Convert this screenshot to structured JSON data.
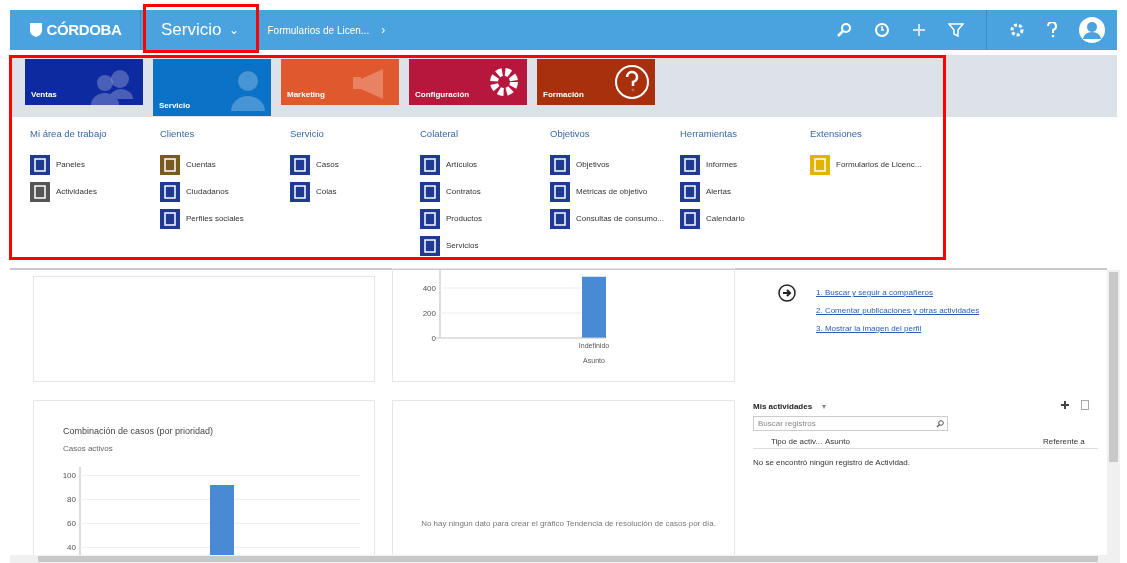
{
  "top_bar": {
    "logo": "CÓRDOBA",
    "area": {
      "label": "Servicio",
      "caret": "⌄",
      "highlighted": true
    },
    "breadcrumb": {
      "label": "Formularios de Licen...",
      "caret": "›"
    }
  },
  "menu": {
    "highlighted": true,
    "tiles": [
      {
        "label": "Ventas",
        "color": "#0e2aa0",
        "selected": false
      },
      {
        "label": "Servicio",
        "color": "#0a72c7",
        "selected": true
      },
      {
        "label": "Marketing",
        "color": "#e0582e",
        "selected": false
      },
      {
        "label": "Configuración",
        "color": "#b8173d",
        "selected": false
      },
      {
        "label": "Formación",
        "color": "#a9300c",
        "selected": false
      }
    ],
    "groups": [
      {
        "title": "Mi área de trabajo",
        "items": [
          "Paneles",
          "Actividades"
        ]
      },
      {
        "title": "Clientes",
        "items": [
          "Cuentas",
          "Ciudadanos",
          "Perfiles sociales"
        ]
      },
      {
        "title": "Servicio",
        "items": [
          "Casos",
          "Colas"
        ]
      },
      {
        "title": "Colateral",
        "items": [
          "Artículos",
          "Contratos",
          "Productos",
          "Servicios"
        ]
      },
      {
        "title": "Objetivos",
        "items": [
          "Objetivos",
          "Métricas de objetivo",
          "Consultas de consumo..."
        ]
      },
      {
        "title": "Herramientas",
        "items": [
          "Informes",
          "Alertas",
          "Calendario"
        ]
      },
      {
        "title": "Extensiones",
        "items": [
          "Formularios de Licenc..."
        ]
      }
    ]
  },
  "dashboard": {
    "chart_top": {
      "chart_data": {
        "type": "bar",
        "xlabel": "Asunto",
        "categories": [
          "Indefinido"
        ],
        "values": [
          490
        ],
        "yticks": [
          0,
          200,
          400
        ],
        "ylim": [
          0,
          544
        ],
        "grid": true
      }
    },
    "chart_bottom": {
      "title": "Combinación de casos (por prioridad)",
      "subtitle": "Casos activos",
      "chart_data": {
        "type": "bar",
        "values": [
          92
        ],
        "yticks": [
          40,
          60,
          80,
          100
        ],
        "ylim": [
          32,
          107
        ],
        "grid": true
      }
    },
    "empty_chart_message": "No hay ningún dato para crear el gráfico Tendencia de resolución de casos por día.",
    "steps": [
      "1. Buscar y seguir a compañeros",
      "2. Comentar publicaciones y otras actividades",
      "3. Mostrar la imagen del perfil"
    ],
    "activities": {
      "title": "Mis actividades",
      "caret": "▾",
      "search": {
        "placeholder": "Buscar registros"
      },
      "columns": [
        "Tipo de activ...",
        "Asunto",
        "Referente a"
      ],
      "empty": "No se encontró ningún registro de Actividad."
    }
  }
}
